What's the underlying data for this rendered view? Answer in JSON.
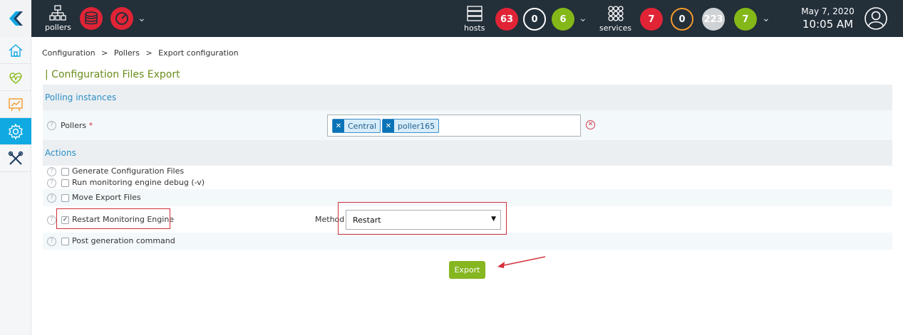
{
  "topbar": {
    "pollers_label": "pollers",
    "hosts_label": "hosts",
    "services_label": "services",
    "host_counts": [
      {
        "value": "63",
        "color": "#e02436"
      },
      {
        "value": "0",
        "color": "#ffffff"
      },
      {
        "value": "6",
        "color": "#84b818"
      }
    ],
    "service_counts": [
      {
        "value": "7",
        "color": "#e02436"
      },
      {
        "value": "0",
        "color": "#f39a2a"
      },
      {
        "value": "223",
        "color": "#cfd3d6"
      },
      {
        "value": "7",
        "color": "#84b818"
      }
    ],
    "date": "May 7, 2020",
    "time": "10:05 AM"
  },
  "breadcrumb": {
    "items": [
      "Configuration",
      "Pollers",
      "Export configuration"
    ],
    "separator": ">"
  },
  "page_title": "| Configuration Files Export",
  "polling": {
    "header": "Polling instances",
    "pollers_label": "Pollers",
    "required_mark": "*",
    "tags": [
      "Central",
      "poller165"
    ]
  },
  "actions": {
    "header": "Actions",
    "items": [
      {
        "label": "Generate Configuration Files",
        "checked": false
      },
      {
        "label": "Run monitoring engine debug (-v)",
        "checked": false
      },
      {
        "label": "Move Export Files",
        "checked": false
      },
      {
        "label": "Restart Monitoring Engine",
        "checked": true
      },
      {
        "label": "Post generation command",
        "checked": false
      }
    ],
    "method_label": "Method",
    "method_value": "Restart"
  },
  "export_label": "Export",
  "colors": {
    "accent": "#10a9e2",
    "section_text": "#2a8ec5",
    "title_green": "#6a8d1a",
    "export_green": "#86b620",
    "highlight_red": "#d42f3a"
  }
}
